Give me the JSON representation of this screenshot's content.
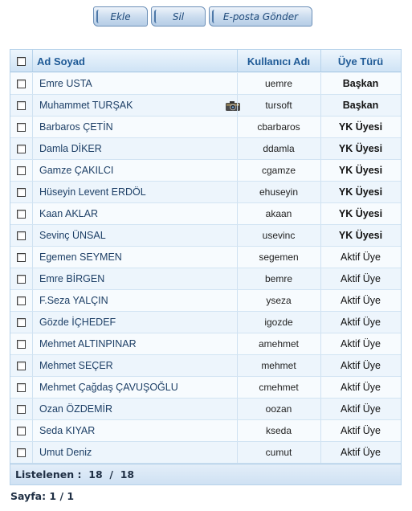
{
  "toolbar": {
    "add_label": "Ekle",
    "delete_label": "Sil",
    "email_label": "E-posta Gönder"
  },
  "table": {
    "headers": {
      "name": "Ad Soyad",
      "username": "Kullanıcı Adı",
      "type": "Üye Türü"
    },
    "rows": [
      {
        "name": "Emre USTA",
        "username": "uemre",
        "type": "Başkan",
        "bold": true,
        "camera": false
      },
      {
        "name": "Muhammet TURŞAK",
        "username": "tursoft",
        "type": "Başkan",
        "bold": true,
        "camera": true
      },
      {
        "name": "Barbaros ÇETİN",
        "username": "cbarbaros",
        "type": "YK Üyesi",
        "bold": true,
        "camera": false
      },
      {
        "name": "Damla DİKER",
        "username": "ddamla",
        "type": "YK Üyesi",
        "bold": true,
        "camera": false
      },
      {
        "name": "Gamze ÇAKILCI",
        "username": "cgamze",
        "type": "YK Üyesi",
        "bold": true,
        "camera": false
      },
      {
        "name": "Hüseyin Levent ERDÖL",
        "username": "ehuseyin",
        "type": "YK Üyesi",
        "bold": true,
        "camera": false
      },
      {
        "name": "Kaan AKLAR",
        "username": "akaan",
        "type": "YK Üyesi",
        "bold": true,
        "camera": false
      },
      {
        "name": "Sevinç ÜNSAL",
        "username": "usevinc",
        "type": "YK Üyesi",
        "bold": true,
        "camera": false
      },
      {
        "name": "Egemen SEYMEN",
        "username": "segemen",
        "type": "Aktif Üye",
        "bold": false,
        "camera": false
      },
      {
        "name": "Emre BİRGEN",
        "username": "bemre",
        "type": "Aktif Üye",
        "bold": false,
        "camera": false
      },
      {
        "name": "F.Seza YALÇIN",
        "username": "yseza",
        "type": "Aktif Üye",
        "bold": false,
        "camera": false
      },
      {
        "name": "Gözde İÇHEDEF",
        "username": "igozde",
        "type": "Aktif Üye",
        "bold": false,
        "camera": false
      },
      {
        "name": "Mehmet ALTINPINAR",
        "username": "amehmet",
        "type": "Aktif Üye",
        "bold": false,
        "camera": false
      },
      {
        "name": "Mehmet SEÇER",
        "username": "mehmet",
        "type": "Aktif Üye",
        "bold": false,
        "camera": false
      },
      {
        "name": "Mehmet Çağdaş ÇAVUŞOĞLU",
        "username": "cmehmet",
        "type": "Aktif Üye",
        "bold": false,
        "camera": false
      },
      {
        "name": "Ozan ÖZDEMİR",
        "username": "oozan",
        "type": "Aktif Üye",
        "bold": false,
        "camera": false
      },
      {
        "name": "Seda KIYAR",
        "username": "kseda",
        "type": "Aktif Üye",
        "bold": false,
        "camera": false
      },
      {
        "name": "Umut Deniz",
        "username": "cumut",
        "type": "Aktif Üye",
        "bold": false,
        "camera": false
      }
    ]
  },
  "footer": {
    "listed_label": "Listelenen :",
    "listed_count": "18",
    "separator": "/",
    "total_count": "18"
  },
  "pager": {
    "text": "Sayfa: 1 / 1"
  },
  "icons": {
    "row_icon": "camera-icon"
  },
  "colors": {
    "header_text": "#1f5a96",
    "name_text": "#1d3f66",
    "grid_bg": "#eaf3fb"
  }
}
